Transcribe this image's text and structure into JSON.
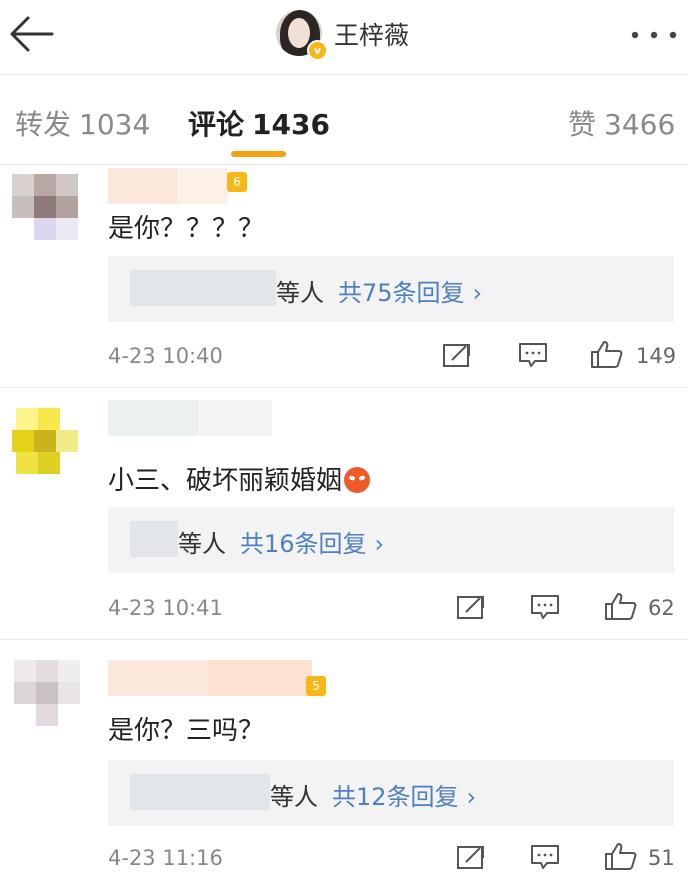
{
  "header": {
    "title": "王梓薇",
    "verified_mark": "v",
    "icons": [
      "back-arrow-icon",
      "more-icon"
    ]
  },
  "tabs": [
    {
      "label": "转发",
      "count": "1034"
    },
    {
      "label": "评论",
      "count": "1436"
    },
    {
      "label": "赞",
      "count": "3466"
    }
  ],
  "comments": [
    {
      "text": "是你？？？？",
      "rank_badge": "6",
      "reply_suffix": "等人",
      "reply_count_label": "共75条回复",
      "reply_chevron": "›",
      "time": "4-23 10:40",
      "likes": "149"
    },
    {
      "text": "小三、破坏丽颖婚姻",
      "reply_suffix": "等人",
      "reply_count_label": "共16条回复",
      "reply_chevron": "›",
      "time": "4-23 10:41",
      "likes": "62"
    },
    {
      "text": "是你？三吗？",
      "rank_badge": "5",
      "reply_suffix": "等人",
      "reply_count_label": "共12条回复",
      "reply_chevron": "›",
      "time": "4-23 11:16",
      "likes": "51"
    }
  ],
  "colors": {
    "accent_orange": "#f7a30f",
    "link_blue": "#4e7fc2",
    "reply_bg": "#f3f3f3",
    "muted_text": "#888888"
  }
}
